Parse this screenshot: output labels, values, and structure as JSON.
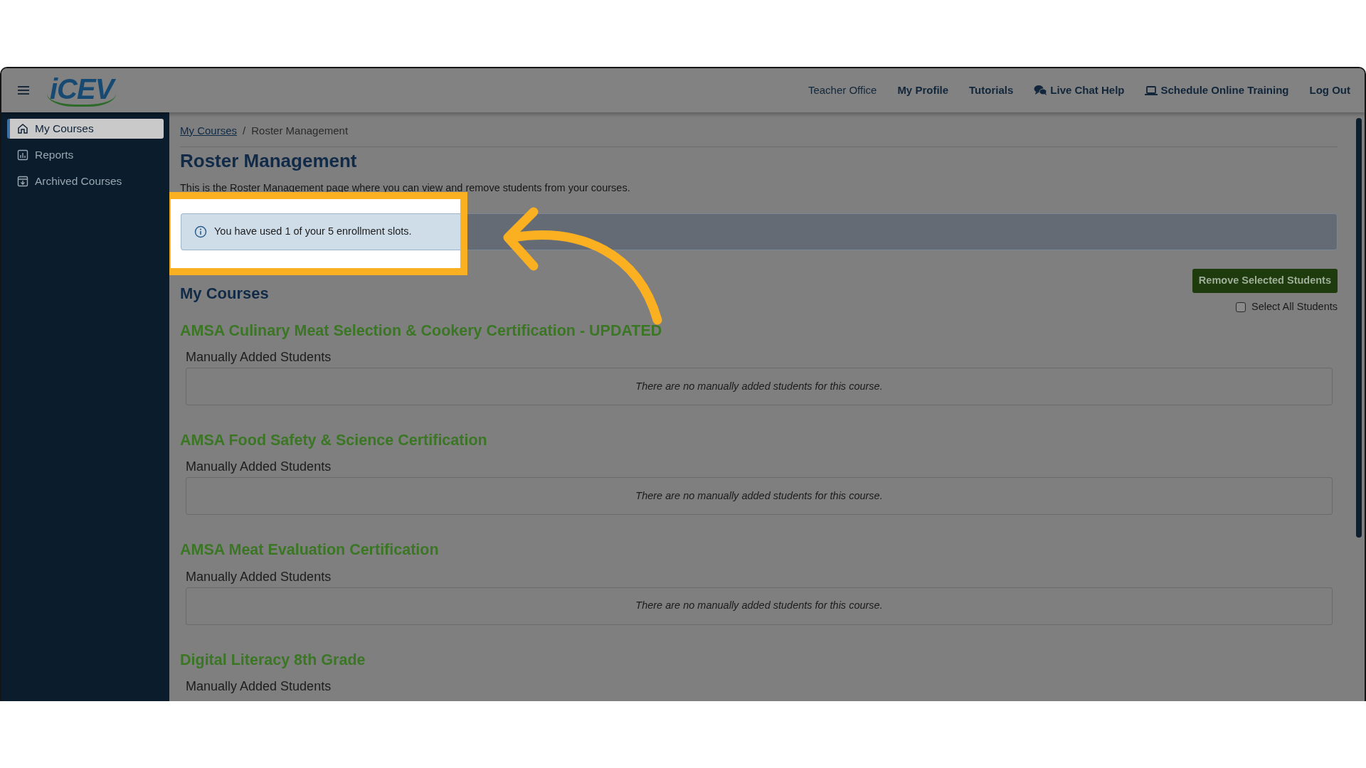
{
  "header": {
    "logo": "iCEV",
    "nav": [
      {
        "label": "Teacher Office",
        "kind": "plain"
      },
      {
        "label": "My Profile",
        "kind": "bold"
      },
      {
        "label": "Tutorials",
        "kind": "bold"
      },
      {
        "label": "Live Chat Help",
        "kind": "chat"
      },
      {
        "label": "Schedule Online Training",
        "kind": "laptop"
      },
      {
        "label": "Log Out",
        "kind": "bold"
      }
    ]
  },
  "sidebar": {
    "items": [
      {
        "label": "My Courses",
        "selected": true
      },
      {
        "label": "Reports",
        "selected": false
      },
      {
        "label": "Archived Courses",
        "selected": false
      }
    ]
  },
  "breadcrumb": [
    {
      "label": "My Courses",
      "kind": "link"
    },
    {
      "label": "Roster Management",
      "kind": "current"
    }
  ],
  "breadcrumb_separator": "/",
  "title": "Roster Management",
  "description": "This is the Roster Management page where you can view and remove students from your courses.",
  "alert": "You have used 1 of your 5 enrollment slots.",
  "section_title": "My Courses",
  "remove_button": "Remove Selected Students",
  "select_all": {
    "label": "Select All Students",
    "checked": false
  },
  "courses": [
    {
      "title": "AMSA Culinary Meat Selection & Cookery Certification - UPDATED",
      "subtitle": "Manually Added Students",
      "empty": "There are no manually added students for this course."
    },
    {
      "title": "AMSA Food Safety & Science Certification",
      "subtitle": "Manually Added Students",
      "empty": "There are no manually added students for this course."
    },
    {
      "title": "AMSA Meat Evaluation Certification",
      "subtitle": "Manually Added Students",
      "empty": "There are no manually added students for this course."
    },
    {
      "title": "Digital Literacy 8th Grade",
      "subtitle": "Manually Added Students"
    }
  ]
}
